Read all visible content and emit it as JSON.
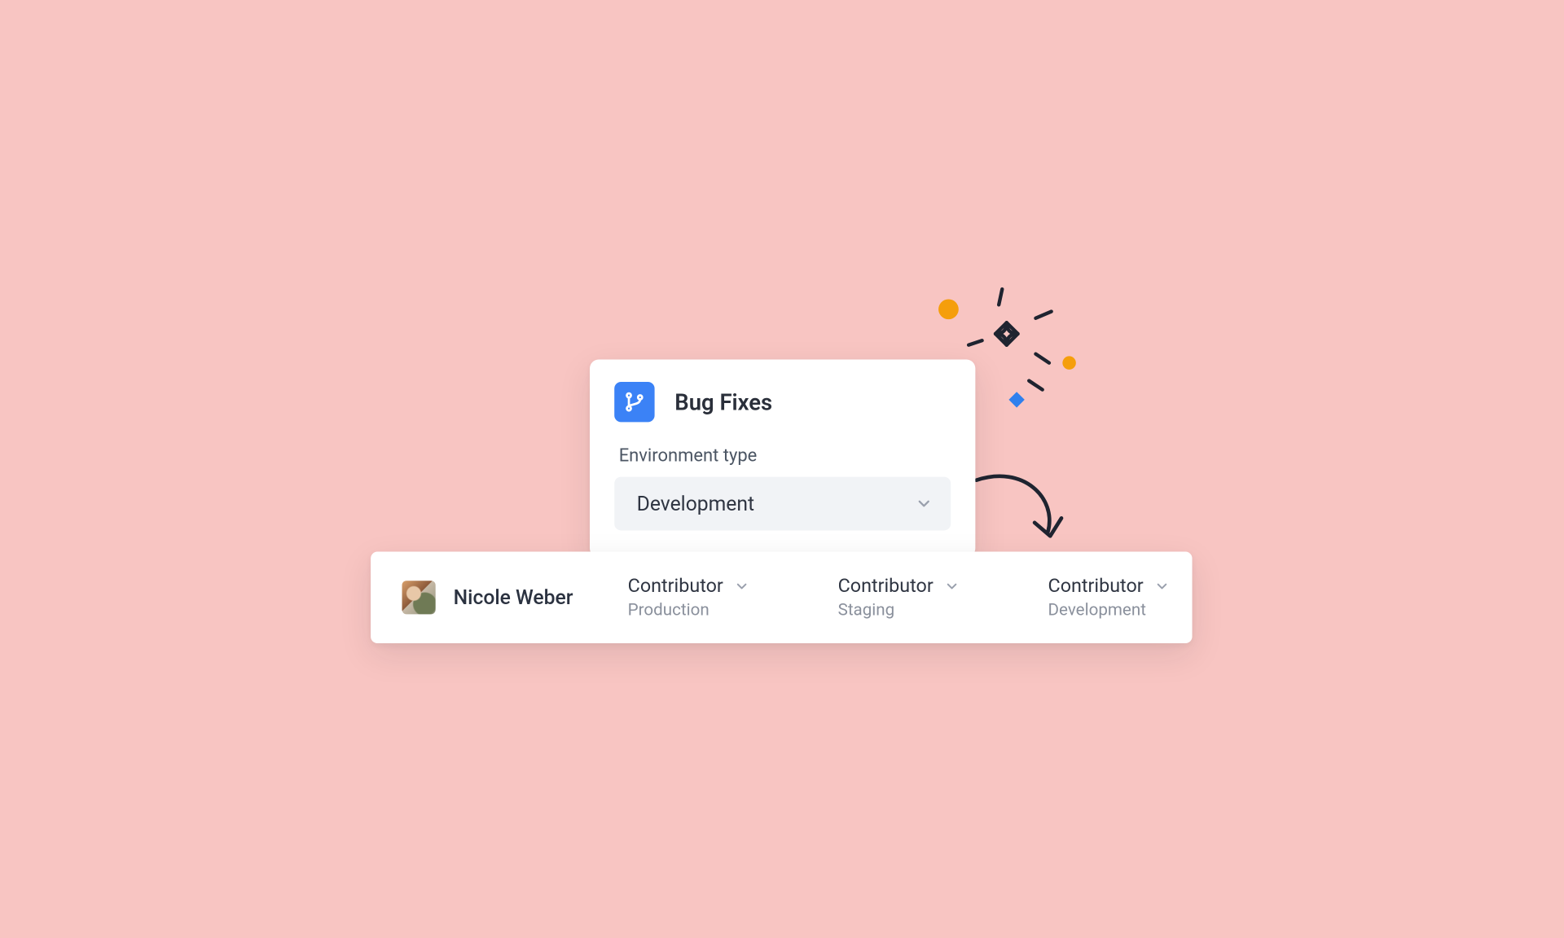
{
  "card": {
    "title": "Bug Fixes",
    "field_label": "Environment type",
    "selected_value": "Development"
  },
  "user": {
    "name": "Nicole Weber"
  },
  "roles": [
    {
      "role": "Contributor",
      "env": "Production"
    },
    {
      "role": "Contributor",
      "env": "Staging"
    },
    {
      "role": "Contributor",
      "env": "Development"
    }
  ],
  "colors": {
    "accent_blue": "#3b82f6",
    "orange": "#f59e0b",
    "ink": "#1f2430"
  }
}
